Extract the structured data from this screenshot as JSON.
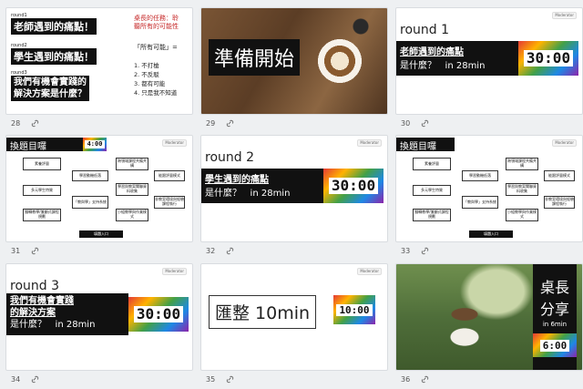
{
  "slides": [
    {
      "num": "28",
      "r1": "round1",
      "q1": "老師遇到的痛點！",
      "r2": "round2",
      "q2": "學生遇到的痛點！",
      "r3": "round3",
      "q3a": "我們有機會實踐的",
      "q3b": "解決方案是什麼？",
      "task_title": "桌長的任務：聆",
      "task_title2": "聽所有的可能性",
      "quote": "「所有可能」=",
      "items": [
        "1. 不打槍",
        "2. 不反駁",
        "3. 都有可能",
        "4. 只是我不知道"
      ]
    },
    {
      "num": "29",
      "title": "準備開始"
    },
    {
      "num": "30",
      "round": "round 1",
      "line1": "老師遇到的痛點",
      "line2a": "是什麼？",
      "line2b": "in 28min",
      "timer": "30:00"
    },
    {
      "num": "31",
      "title": "換題目囉",
      "timer": "4:00",
      "boxes": [
        "素養評量",
        "學習動機低落",
        "跨領域課程共備共構",
        "能跟評量模式",
        "多元學生特質",
        "「教與學」支持系統",
        "學習與教案關聯資料收集",
        "非教室環境與經驗課程執行",
        "翻轉教學/兼顧式課程規劃",
        "小組教學與作業模式"
      ],
      "footer": "填題入口"
    },
    {
      "num": "32",
      "round": "round 2",
      "line1": "學生遇到的痛點",
      "line2a": "是什麼？",
      "line2b": "in 28min",
      "timer": "30:00"
    },
    {
      "num": "33",
      "title": "換題目囉",
      "boxes": [
        "素養評量",
        "學習動機低落",
        "跨領域課程共備共構",
        "能跟評量模式",
        "多元學生特質",
        "「教與學」支持系統",
        "學習與教案關聯資料收集",
        "非教室環境與經驗課程執行",
        "翻轉教學/兼顧式課程規劃",
        "小組教學與作業模式"
      ],
      "footer": "填題入口"
    },
    {
      "num": "34",
      "round": "round 3",
      "line1": "我們有機會實踐",
      "line1b": "的解決方案",
      "line2a": "是什麼？",
      "line2b": "in 28min",
      "timer": "30:00"
    },
    {
      "num": "35",
      "title": "匯整 10min",
      "timer": "10:00"
    },
    {
      "num": "36",
      "t1": "桌長",
      "t2": "分享",
      "t3": "in 6min",
      "timer": "6:00"
    }
  ],
  "badge": "Moderator"
}
